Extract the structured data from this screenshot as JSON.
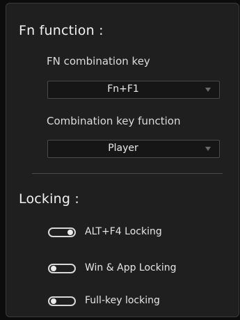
{
  "fn_section": {
    "title": "Fn function :",
    "combination_key": {
      "label": "FN combination key",
      "selected": "Fn+F1"
    },
    "combination_function": {
      "label": "Combination key function",
      "selected": "Player"
    }
  },
  "locking_section": {
    "title": "Locking :",
    "items": [
      {
        "label": "ALT+F4  Locking",
        "state": "on"
      },
      {
        "label": "Win & App Locking",
        "state": "off"
      },
      {
        "label": "Full-key locking",
        "state": "off"
      }
    ]
  },
  "colors": {
    "panel_background": "#1f1f20",
    "page_background": "#0c0c0c",
    "text": "#e8e8e8",
    "border": "#4a4a4c"
  }
}
